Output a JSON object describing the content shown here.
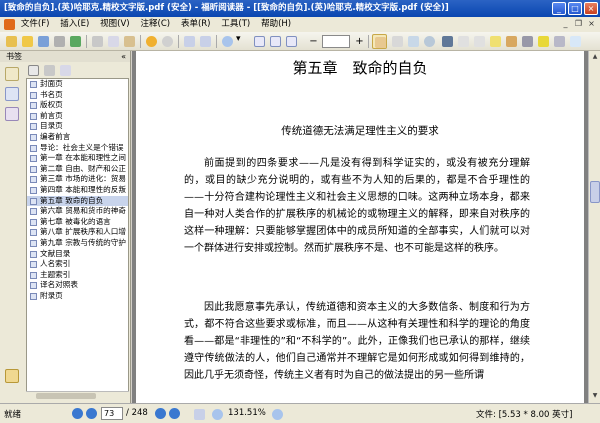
{
  "window": {
    "title": "[致命的自负].(英)哈耶克.精校文字版.pdf (安全) - 福昕阅读器 - [[致命的自负].(英)哈耶克.精校文字版.pdf (安全)]",
    "minimize": "_",
    "maximize": "□",
    "close": "×"
  },
  "menu": {
    "items": [
      "文件(F)",
      "插入(E)",
      "视图(V)",
      "注释(C)",
      "表单(R)",
      "工具(T)",
      "帮助(H)"
    ],
    "doc_minimize": "_",
    "doc_restore": "❐",
    "doc_close": "×"
  },
  "toolbar": {
    "zoom_minus": "−",
    "zoom_plus": "+",
    "dropdown_arrow": "▾"
  },
  "sidebar": {
    "title": "书签",
    "close": "«",
    "bookmarks": [
      {
        "label": "封面页",
        "selected": false
      },
      {
        "label": "书名页",
        "selected": false
      },
      {
        "label": "版权页",
        "selected": false
      },
      {
        "label": "前言页",
        "selected": false
      },
      {
        "label": "目录页",
        "selected": false
      },
      {
        "label": "编者前言",
        "selected": false
      },
      {
        "label": "导论：社会主义是个错误",
        "selected": false
      },
      {
        "label": "第一章 在本能和理性之间",
        "selected": false
      },
      {
        "label": "第二章 自由、财产和公正",
        "selected": false
      },
      {
        "label": "第三章 市场的进化：贸易",
        "selected": false
      },
      {
        "label": "第四章 本能和理性的反叛",
        "selected": false
      },
      {
        "label": "第五章 致命的自负",
        "selected": true
      },
      {
        "label": "第六章 贸易和货币的神奇",
        "selected": false
      },
      {
        "label": "第七章 被毒化的语言",
        "selected": false
      },
      {
        "label": "第八章 扩展秩序和人口增",
        "selected": false
      },
      {
        "label": "第九章 宗教与传统的守护",
        "selected": false
      },
      {
        "label": "文献目录",
        "selected": false
      },
      {
        "label": "人名索引",
        "selected": false
      },
      {
        "label": "主题索引",
        "selected": false
      },
      {
        "label": "译名对照表",
        "selected": false
      },
      {
        "label": "附录页",
        "selected": false
      }
    ]
  },
  "document": {
    "chapter_title": "第五章　致命的自负",
    "section_title": "传统道德无法满足理性主义的要求",
    "paragraph1": "前面提到的四条要求——凡是没有得到科学证实的，或没有被充分理解的，或目的缺少充分说明的，或有些不为人知的后果的，都是不合乎理性的——十分符合建构论理性主义和社会主义思想的口味。这两种立场本身，都来自一种对人类合作的扩展秩序的机械论的或物理主义的解释，即来自对秩序的这样一种理解：只要能够掌握团体中的成员所知道的全部事实，人们就可以对一个群体进行安排或控制。然而扩展秩序不是、也不可能是这样的秩序。",
    "paragraph2": "因此我愿意事先承认，传统道德和资本主义的大多数信条、制度和行为方式，都不符合这些要求或标准，而且——从这种有关理性和科学的理论的角度看——都是“非理性的”和“不科学的”。此外，正像我们也已承认的那样，继续遵守传统做法的人，他们自己通常并不理解它是如何形成或如何得到维持的，因此几乎无须奇怪，传统主义者有时为自己的做法提出的另一些所谓"
  },
  "statusbar": {
    "ready": "就绪",
    "current_page": "73",
    "page_total": "/ 248",
    "zoom": "131.51%",
    "doc_size": "文件: [5.53 * 8.00 英寸]"
  }
}
